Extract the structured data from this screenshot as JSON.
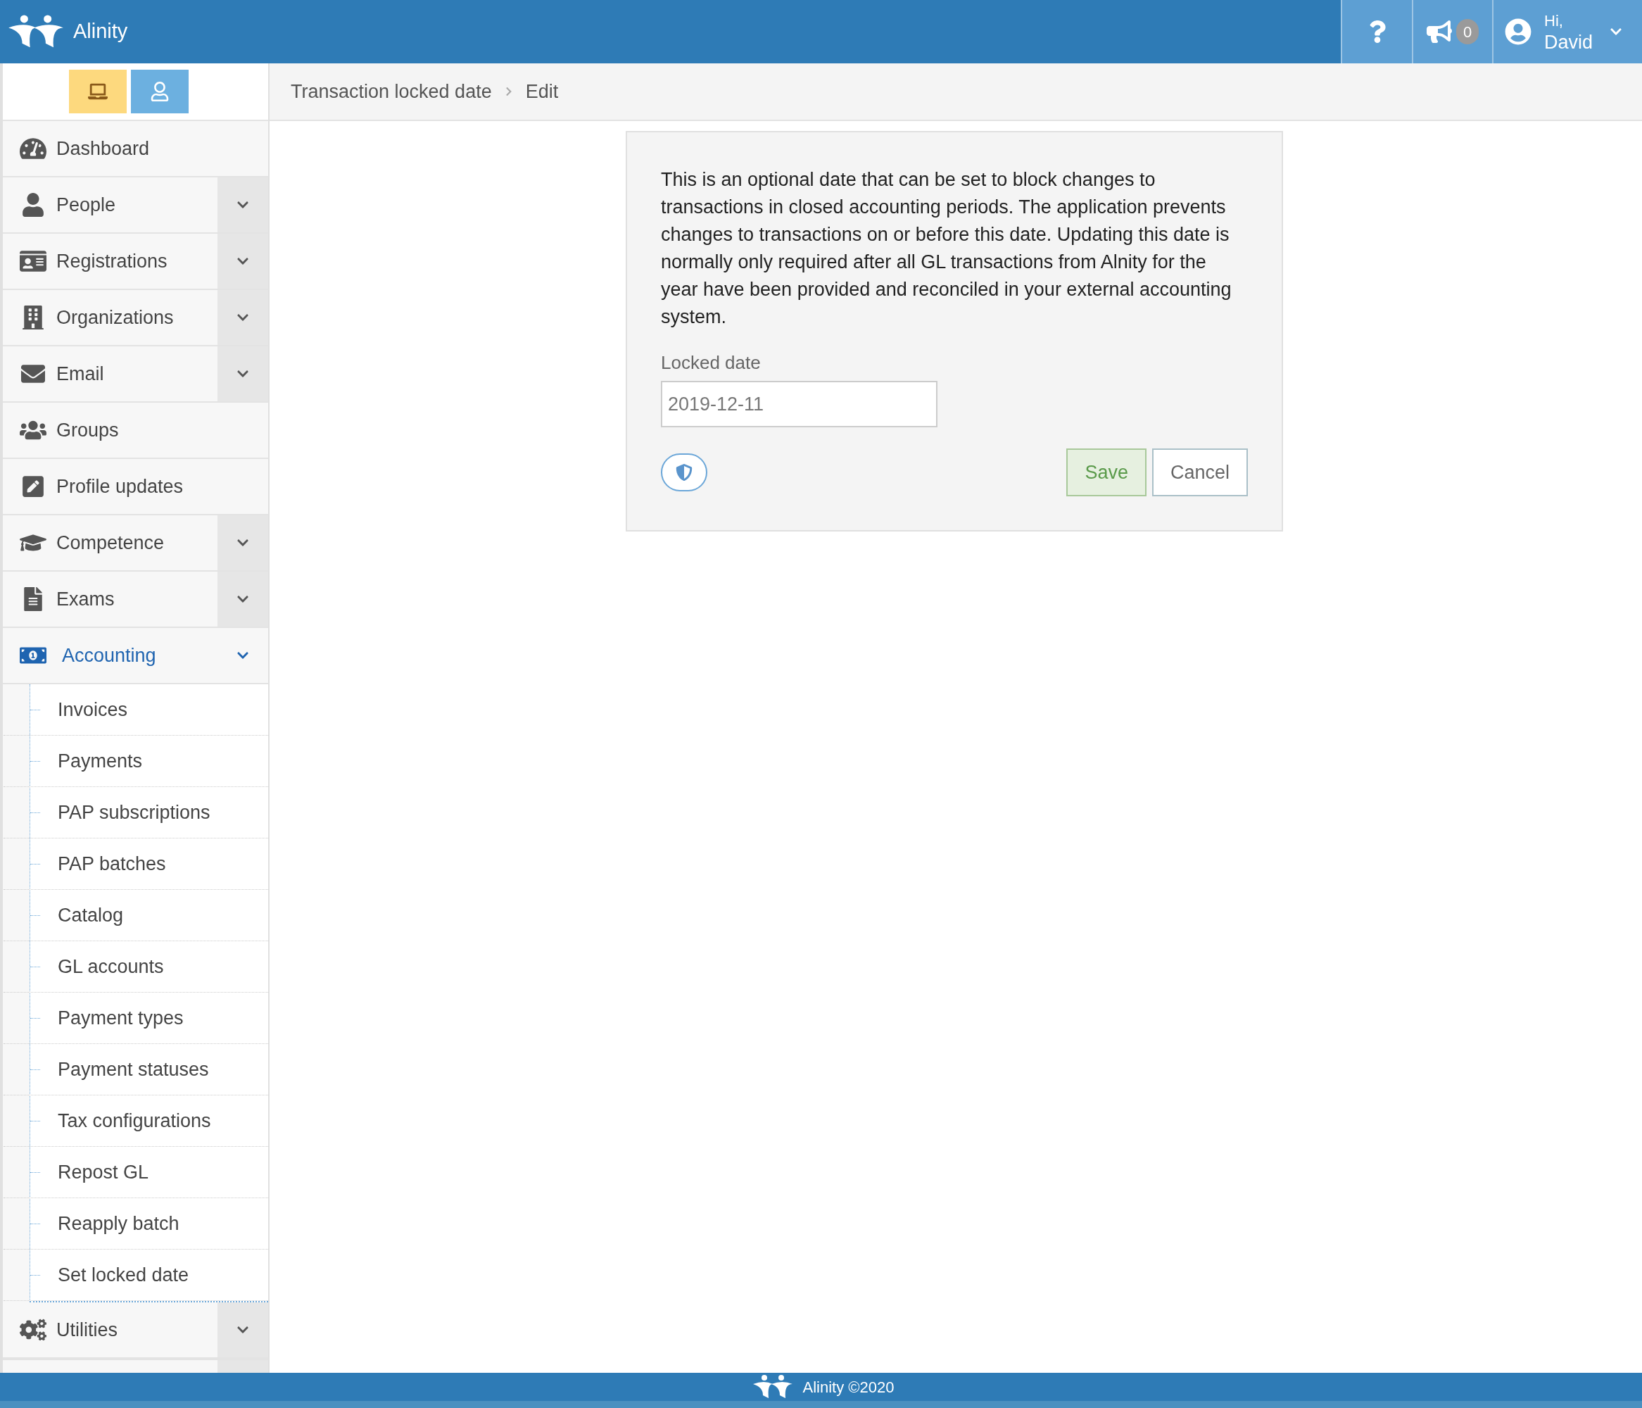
{
  "header": {
    "brand": "Alinity",
    "notifications": {
      "count": "0"
    },
    "user": {
      "greeting": "Hi,",
      "name": "David"
    }
  },
  "mode_buttons": [
    {
      "kind": "desktop",
      "selected": true
    },
    {
      "kind": "user",
      "selected": false
    }
  ],
  "sidebar": {
    "items": [
      {
        "label": "Dashboard",
        "has_submenu": false,
        "selected": false
      },
      {
        "label": "People",
        "has_submenu": true,
        "expanded": false,
        "selected": false
      },
      {
        "label": "Registrations",
        "has_submenu": true,
        "expanded": false,
        "selected": false
      },
      {
        "label": "Organizations",
        "has_submenu": true,
        "expanded": false,
        "selected": false
      },
      {
        "label": "Email",
        "has_submenu": true,
        "expanded": false,
        "selected": false
      },
      {
        "label": "Groups",
        "has_submenu": false,
        "selected": false
      },
      {
        "label": "Profile updates",
        "has_submenu": false,
        "selected": false
      },
      {
        "label": "Competence",
        "has_submenu": true,
        "expanded": false,
        "selected": false
      },
      {
        "label": "Exams",
        "has_submenu": true,
        "expanded": false,
        "selected": false
      },
      {
        "label": "Accounting",
        "has_submenu": true,
        "expanded": true,
        "selected": true,
        "children": [
          {
            "label": "Invoices"
          },
          {
            "label": "Payments"
          },
          {
            "label": "PAP subscriptions"
          },
          {
            "label": "PAP batches"
          },
          {
            "label": "Catalog"
          },
          {
            "label": "GL accounts"
          },
          {
            "label": "Payment types"
          },
          {
            "label": "Payment statuses"
          },
          {
            "label": "Tax configurations"
          },
          {
            "label": "Repost GL"
          },
          {
            "label": "Reapply batch"
          },
          {
            "label": "Set locked date"
          }
        ]
      },
      {
        "label": "Utilities",
        "has_submenu": true,
        "expanded": false,
        "selected": false
      }
    ]
  },
  "breadcrumb": [
    "Transaction locked date",
    "Edit"
  ],
  "form": {
    "description": "This is an optional date that can be set to block changes to transactions in closed accounting periods. The application prevents changes to transactions on or before this date. Updating this date is normally only required after all GL transactions from Alnity for the year have been provided and reconciled in your external accounting system.",
    "field": {
      "label": "Locked date",
      "value": "2019-12-11"
    },
    "buttons": [
      {
        "kind": "primary",
        "label": "Save"
      },
      {
        "kind": "secondary",
        "label": "Cancel"
      }
    ]
  },
  "footer": {
    "text": "Alinity ©2020"
  }
}
